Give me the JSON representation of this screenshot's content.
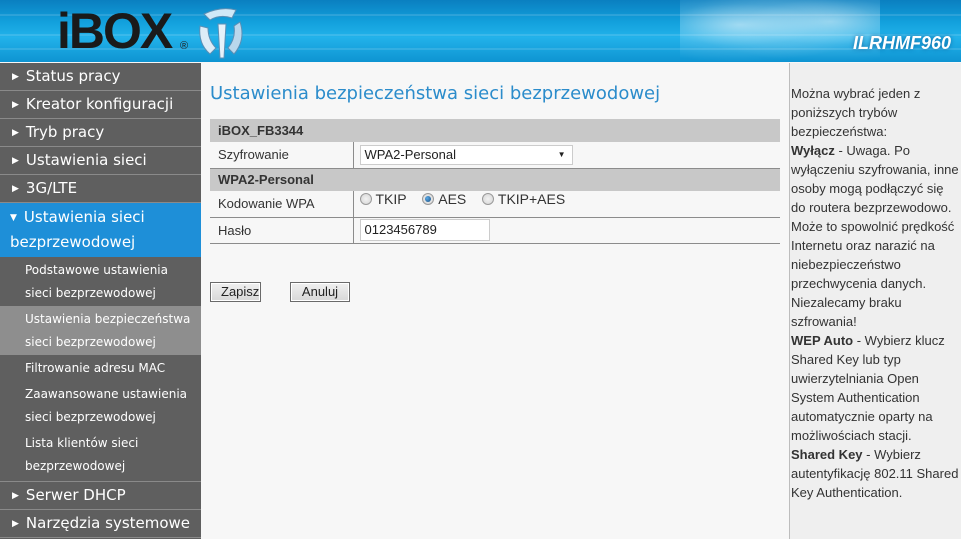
{
  "header": {
    "logo_text": "iBOX",
    "logo_reg": "®",
    "model": "ILRHMF960"
  },
  "sidebar": {
    "items": [
      {
        "label": "Status pracy"
      },
      {
        "label": "Kreator konfiguracji"
      },
      {
        "label": "Tryb pracy"
      },
      {
        "label": "Ustawienia sieci"
      },
      {
        "label": "3G/LTE"
      },
      {
        "label": "Ustawienia sieci bezprzewodowej",
        "expanded": true,
        "children": [
          {
            "label": "Podstawowe ustawienia sieci bezprzewodowej"
          },
          {
            "label": "Ustawienia bezpieczeństwa sieci bezprzewodowej",
            "selected": true
          },
          {
            "label": "Filtrowanie adresu MAC"
          },
          {
            "label": "Zaawansowane ustawienia sieci bezprzewodowej"
          },
          {
            "label": "Lista klientów sieci bezprzewodowej"
          }
        ]
      },
      {
        "label": "Serwer DHCP"
      },
      {
        "label": "Narzędzia systemowe"
      }
    ],
    "collapsed_arrow": "▶",
    "expanded_arrow": "▼"
  },
  "main": {
    "title": "Ustawienia bezpieczeństwa sieci bezprzewodowej",
    "ssid_section": "iBOX_FB3344",
    "encryption_label": "Szyfrowanie",
    "encryption_value": "WPA2-Personal",
    "wpa_section": "WPA2-Personal",
    "wpa_cipher_label": "Kodowanie WPA",
    "wpa_cipher_options": [
      {
        "label": "TKIP",
        "checked": false
      },
      {
        "label": "AES",
        "checked": true
      },
      {
        "label": "TKIP+AES",
        "checked": false
      }
    ],
    "password_label": "Hasło",
    "password_value": "0123456789",
    "save_label": "Zapisz",
    "cancel_label": "Anuluj"
  },
  "help": {
    "intro": "Można wybrać jeden z poniższych trybów bezpieczeństwa:",
    "entries": [
      {
        "term": "Wyłącz",
        "text": " - Uwaga. Po wyłączeniu szyfrowania, inne osoby mogą podłączyć się do routera bezprzewodowo. Może to spowolnić prędkość Internetu oraz narazić na niebezpieczeństwo przechwycenia danych. Niezalecamy braku szfrowania!"
      },
      {
        "term": "WEP Auto",
        "text": " - Wybierz klucz Shared Key lub typ uwierzytelniania Open System Authentication automatycznie oparty na możliwościach stacji."
      },
      {
        "term": "Shared Key",
        "text": " - Wybierz autentyfikację 802.11 Shared Key Authentication."
      }
    ]
  }
}
